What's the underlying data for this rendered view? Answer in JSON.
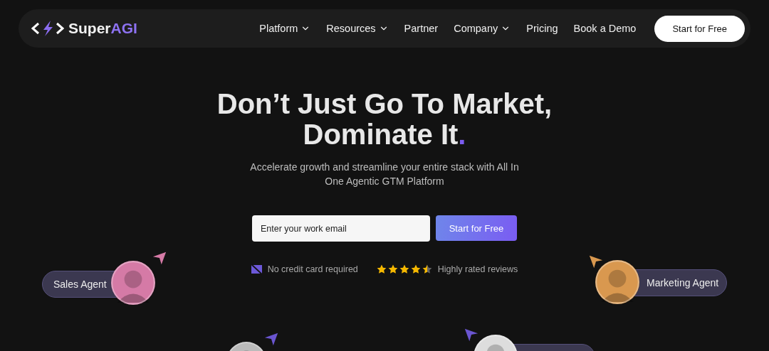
{
  "nav": {
    "logo": {
      "name": "Super",
      "accent": "AGI"
    },
    "items": [
      {
        "label": "Platform",
        "dropdown": true
      },
      {
        "label": "Resources",
        "dropdown": true
      },
      {
        "label": "Partner",
        "dropdown": false
      },
      {
        "label": "Company",
        "dropdown": true
      },
      {
        "label": "Pricing",
        "dropdown": false
      },
      {
        "label": "Book a Demo",
        "dropdown": false
      }
    ],
    "cta": "Start for Free"
  },
  "hero": {
    "title_line1": "Don’t Just Go To Market,",
    "title_line2": "Dominate It",
    "title_dot": ".",
    "subtitle": "Accelerate growth and streamline your entire stack with All In One Agentic GTM Platform",
    "email": {
      "placeholder": "Enter your work email"
    },
    "submit": "Start for Free"
  },
  "trust": {
    "card_note": "No credit card required",
    "stars": 4.5,
    "reviews": "Highly rated reviews"
  },
  "agents": [
    {
      "name": "Sales Agent",
      "color": "#d57aa6"
    },
    {
      "name": "Marketing Agent",
      "color": "#d9984f"
    }
  ],
  "lower_agents": [
    {
      "color": "#6a55d0"
    },
    {
      "color": "#6a55d0"
    }
  ]
}
